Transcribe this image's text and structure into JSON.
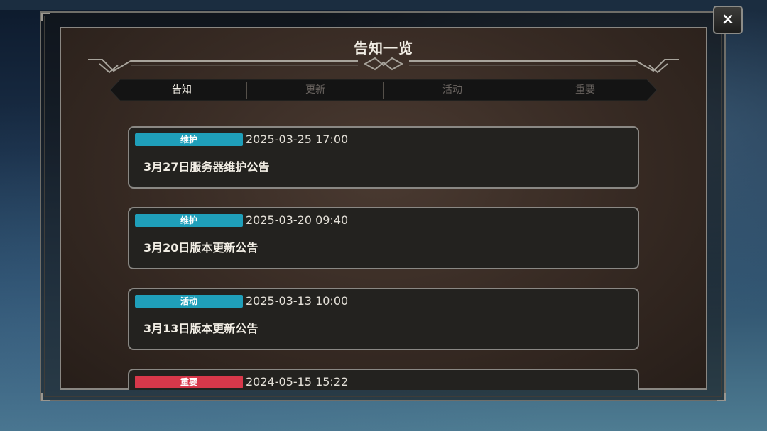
{
  "window": {
    "title": "告知一览",
    "close_icon": "×"
  },
  "tabs": [
    {
      "label": "告知",
      "active": true
    },
    {
      "label": "更新",
      "active": false
    },
    {
      "label": "活动",
      "active": false
    },
    {
      "label": "重要",
      "active": false
    }
  ],
  "notices": [
    {
      "tag": "维护",
      "tag_color": "#1f9fba",
      "date": "2025-03-25 17:00",
      "title": "3月27日服务器维护公告"
    },
    {
      "tag": "维护",
      "tag_color": "#1f9fba",
      "date": "2025-03-20 09:40",
      "title": "3月20日版本更新公告"
    },
    {
      "tag": "活动",
      "tag_color": "#1f9fba",
      "date": "2025-03-13 10:00",
      "title": "3月13日版本更新公告"
    },
    {
      "tag": "重要",
      "tag_color": "#d8384a",
      "date": "2024-05-15 15:22",
      "title": ""
    }
  ],
  "colors": {
    "accent_cyan": "#1f9fba",
    "accent_red": "#d8384a",
    "panel_brown": "#382b24"
  }
}
